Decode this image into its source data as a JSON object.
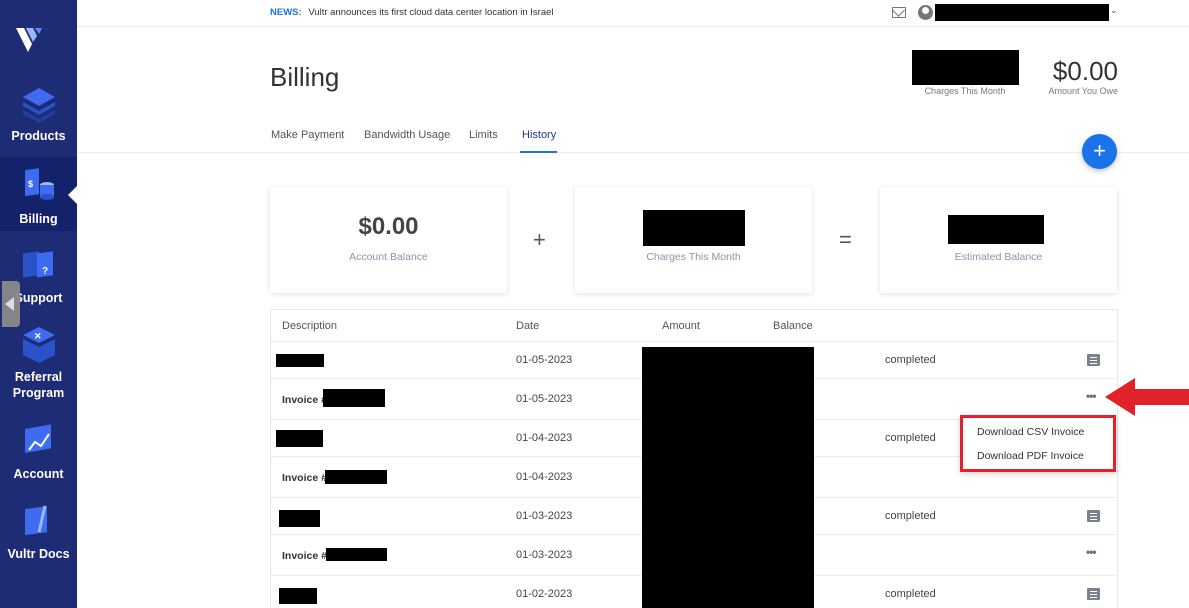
{
  "sidebar": {
    "items": [
      {
        "label": "Products"
      },
      {
        "label": "Billing"
      },
      {
        "label": "Support"
      },
      {
        "label": "Referral Program"
      },
      {
        "label": "Account"
      },
      {
        "label": "Vultr Docs"
      }
    ]
  },
  "topbar": {
    "news_label": "NEWS:",
    "news_text": "Vultr announces its first cloud data center location in Israel"
  },
  "header": {
    "title": "Billing",
    "charges_caption": "Charges This Month",
    "amount_owed": "$0.00",
    "amount_owed_caption": "Amount You Owe"
  },
  "tabs": [
    {
      "label": "Make Payment"
    },
    {
      "label": "Bandwidth Usage"
    },
    {
      "label": "Limits"
    },
    {
      "label": "History"
    }
  ],
  "fab": {
    "label": "+"
  },
  "summary": {
    "account_balance_value": "$0.00",
    "account_balance_caption": "Account Balance",
    "plus": "+",
    "charges_caption": "Charges This Month",
    "equals": "=",
    "estimated_caption": "Estimated Balance"
  },
  "table": {
    "headers": [
      "Description",
      "Date",
      "Amount",
      "Balance"
    ],
    "rows": [
      {
        "prefix": "",
        "date": "01-05-2023",
        "status": "completed"
      },
      {
        "prefix": "Invoice #",
        "date": "01-05-2023",
        "status": ""
      },
      {
        "prefix": "",
        "date": "01-04-2023",
        "status": "completed"
      },
      {
        "prefix": "Invoice #",
        "date": "01-04-2023",
        "status": ""
      },
      {
        "prefix": "",
        "date": "01-03-2023",
        "status": "completed"
      },
      {
        "prefix": "Invoice #",
        "date": "01-03-2023",
        "status": ""
      },
      {
        "prefix": "",
        "date": "01-02-2023",
        "status": "completed"
      }
    ]
  },
  "dropdown": {
    "items": [
      "Download CSV Invoice",
      "Download PDF Invoice"
    ]
  },
  "colors": {
    "sidebar": "#1e2c75",
    "accent": "#1a73e8",
    "highlight": "#e3212b"
  }
}
